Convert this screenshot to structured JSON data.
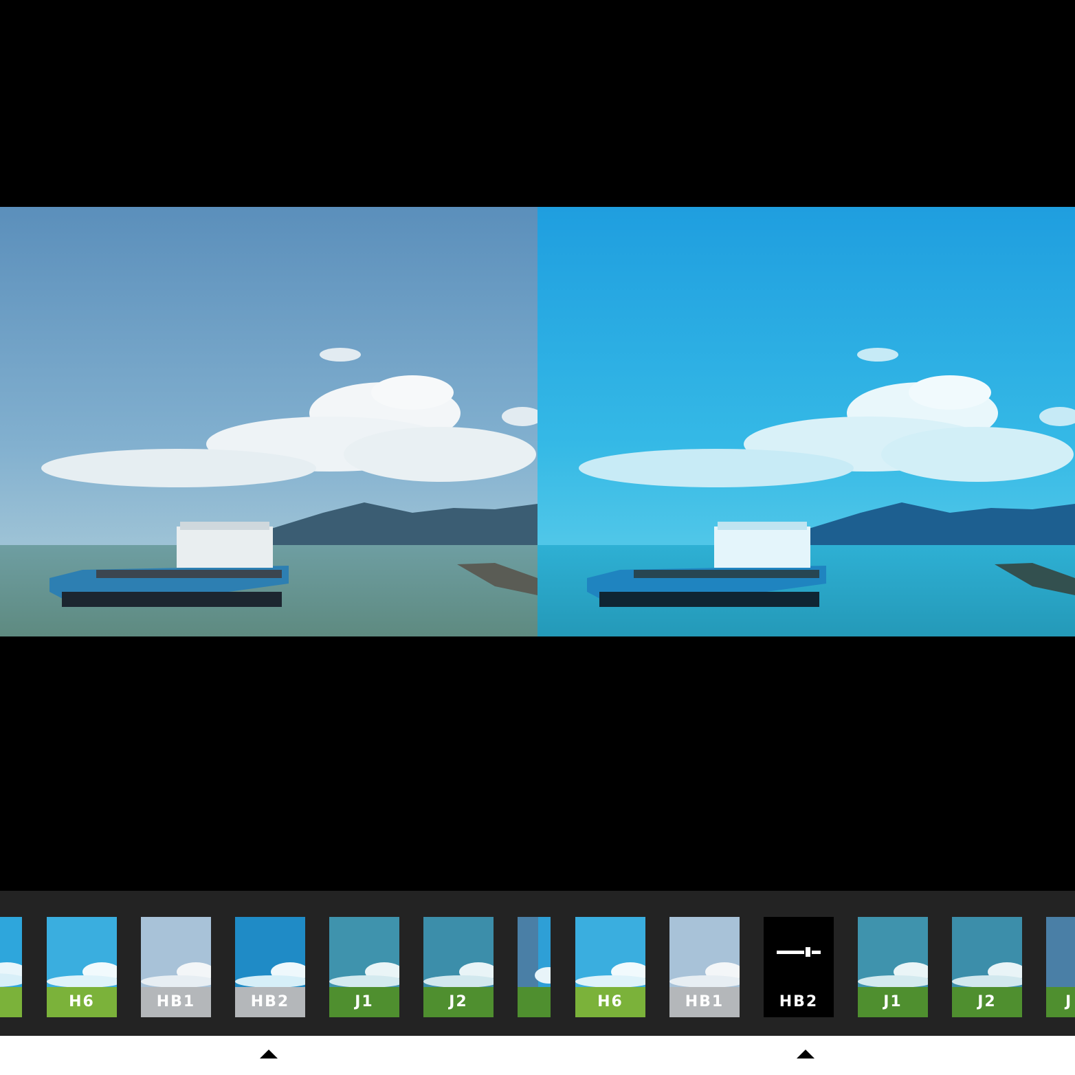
{
  "comparison": {
    "left_panel": "original",
    "right_panel": "filtered"
  },
  "filter_strip_left": [
    {
      "label": "",
      "color": "#7bb23a",
      "photo": "teal"
    },
    {
      "label": "H6",
      "color": "#7bb23a",
      "photo": "teal"
    },
    {
      "label": "HB1",
      "color": "#b4b7ba",
      "photo": "pale"
    },
    {
      "label": "HB2",
      "color": "#b4b7ba",
      "photo": "deep"
    },
    {
      "label": "J1",
      "color": "#4f8f2f",
      "photo": "sea"
    },
    {
      "label": "J2",
      "color": "#4f8f2f",
      "photo": "sea"
    },
    {
      "label": "",
      "color": "#4f8f2f",
      "photo": "slate"
    }
  ],
  "filter_strip_right": [
    {
      "label": "H6",
      "color": "#7bb23a",
      "photo": "teal"
    },
    {
      "label": "HB1",
      "color": "#b4b7ba",
      "photo": "pale"
    },
    {
      "label": "HB2",
      "color": "#000000",
      "photo": "selected"
    },
    {
      "label": "J1",
      "color": "#4f8f2f",
      "photo": "sea"
    },
    {
      "label": "J2",
      "color": "#4f8f2f",
      "photo": "sea"
    },
    {
      "label": "J",
      "color": "#4f8f2f",
      "photo": "slate"
    }
  ],
  "icons": {
    "selected_filter_icon": "slider-adjust-icon",
    "position_marker_icon": "caret-up-icon"
  }
}
